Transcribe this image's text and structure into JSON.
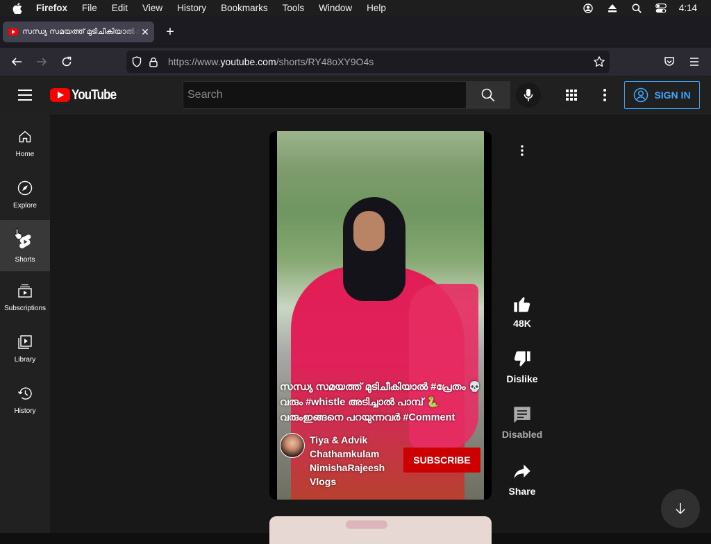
{
  "menubar": {
    "app_name": "Firefox",
    "items": [
      "File",
      "Edit",
      "View",
      "History",
      "Bookmarks",
      "Tools",
      "Window",
      "Help"
    ],
    "clock": "4:14",
    "status_icons": [
      "user-account-icon",
      "eject-icon",
      "spotlight-search-icon",
      "control-center-icon"
    ]
  },
  "browser": {
    "tab_title": "സന്ധ്യ സമയത്ത് മുടിചീകിയാൽ #പ്രേതം",
    "new_tab_label": "+",
    "url_prefix": "https://www.",
    "url_host": "youtube.com",
    "url_path": "/shorts/RY48oXY9O4s"
  },
  "youtube": {
    "logo_text": "YouTube",
    "search_placeholder": "Search",
    "sign_in": "SIGN IN",
    "sidebar": [
      {
        "label": "Home",
        "icon": "home-icon"
      },
      {
        "label": "Explore",
        "icon": "compass-icon"
      },
      {
        "label": "Shorts",
        "icon": "shorts-icon",
        "active": true
      },
      {
        "label": "Subscriptions",
        "icon": "subscriptions-icon"
      },
      {
        "label": "Library",
        "icon": "library-icon"
      },
      {
        "label": "History",
        "icon": "history-icon"
      }
    ],
    "video": {
      "caption": "സന്ധ്യ സമയത്ത് മുടിചീകിയാൽ #പ്രേതം 💀 വരും #whistle അടിച്ചാൽ പാമ്പ് 🐍 വരുംഇങ്ങനെ പറയുന്നവർ #Comment",
      "channel_name": "Tiya & Advik Chathamkulam NimishaRajeesh Vlogs",
      "subscribe": "SUBSCRIBE"
    },
    "actions": {
      "like_count": "48K",
      "dislike": "Dislike",
      "comments": "Disabled",
      "share": "Share"
    }
  },
  "colors": {
    "accent_blue": "#3ea6ff",
    "youtube_red": "#ff0000",
    "subscribe_red": "#cc0000"
  }
}
